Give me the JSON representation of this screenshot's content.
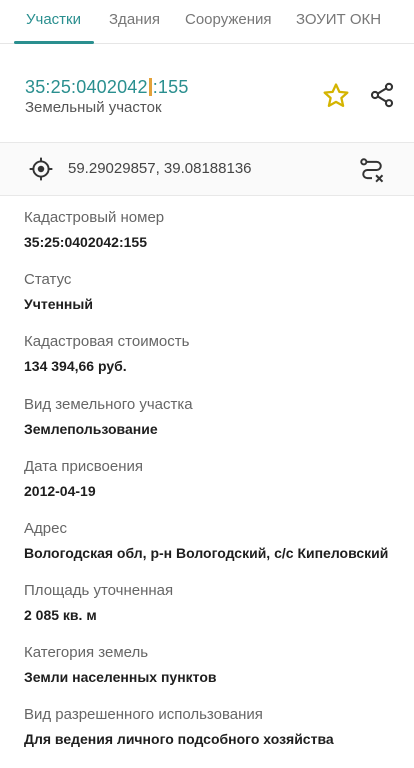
{
  "tabs": [
    {
      "label": "Участки",
      "active": true
    },
    {
      "label": "Здания",
      "active": false
    },
    {
      "label": "Сооружения",
      "active": false
    },
    {
      "label": "ЗОУИТ ОКН",
      "active": false
    }
  ],
  "header": {
    "title_part1": "35:25:0402042",
    "title_part2": ":155",
    "subtitle": "Земельный участок",
    "star_icon": "star-outline-icon",
    "share_icon": "share-icon",
    "accent": "#2a8f8f",
    "star_color": "#d4b400"
  },
  "coords": {
    "icon": "crosshair-location-icon",
    "text": "59.29029857, 39.08188136",
    "route_icon": "route-clear-icon"
  },
  "fields": [
    {
      "label": "Кадастровый номер",
      "value": "35:25:0402042:155"
    },
    {
      "label": "Статус",
      "value": "Учтенный"
    },
    {
      "label": "Кадастровая стоимость",
      "value": "134 394,66 руб."
    },
    {
      "label": "Вид земельного участка",
      "value": "Землепользование"
    },
    {
      "label": "Дата присвоения",
      "value": "2012-04-19"
    },
    {
      "label": "Адрес",
      "value": "Вологодская обл, р-н Вологодский, с/с Кипеловский"
    },
    {
      "label": "Площадь уточненная",
      "value": "2 085 кв. м"
    },
    {
      "label": "Категория земель",
      "value": "Земли населенных пунктов"
    },
    {
      "label": "Вид разрешенного использования",
      "value": "Для ведения личного подсобного хозяйства"
    }
  ]
}
